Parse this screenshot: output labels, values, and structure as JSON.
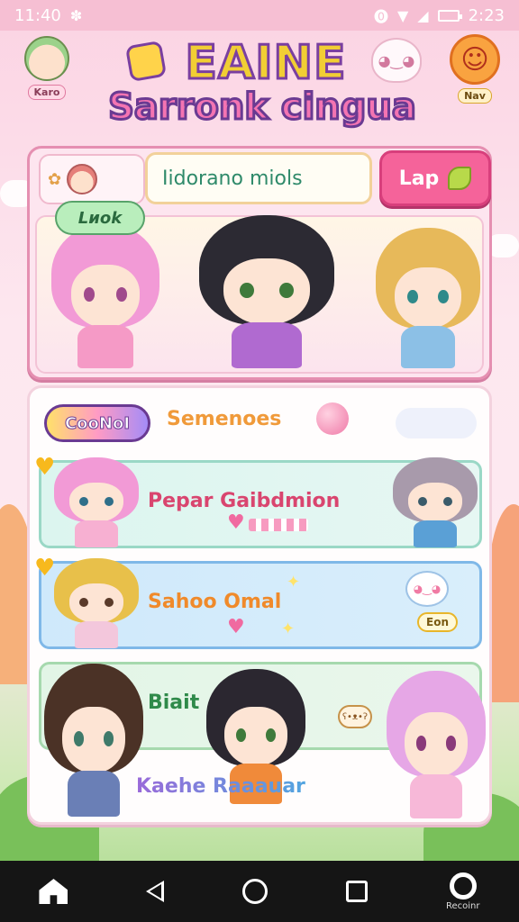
{
  "status_bar": {
    "time": "11:40",
    "right_time": "2:23"
  },
  "header": {
    "logo_line1": "EAINE",
    "logo_line2": "Sarronk cingua",
    "left_caption": "Karo",
    "right_caption": "Nav"
  },
  "top_card": {
    "name_field_value": "Iidorano miols",
    "lap_button_label": "Lap",
    "tag_bubble": "Lиok"
  },
  "panel": {
    "combo_badge": "CooNoI",
    "title": "Semenoes",
    "rows": [
      {
        "label": "Pepar Gaibdmion"
      },
      {
        "label": "Sahoo Omal",
        "badge": "Eon"
      },
      {
        "label": "Biait"
      }
    ],
    "footer_label": "Kaehe Raaauar"
  },
  "navbar": {
    "record_caption": "Recoinr"
  },
  "colors": {
    "accent_pink": "#f5639a",
    "status_bar": "#f6bfd3",
    "nav_bg": "#151515"
  },
  "icons": [
    "wifi-icon",
    "signal-icon",
    "battery-icon",
    "leaf-icon",
    "balloon-icon",
    "heart-icon",
    "home-icon",
    "back-icon",
    "circle-home-icon",
    "recents-icon",
    "record-icon"
  ]
}
